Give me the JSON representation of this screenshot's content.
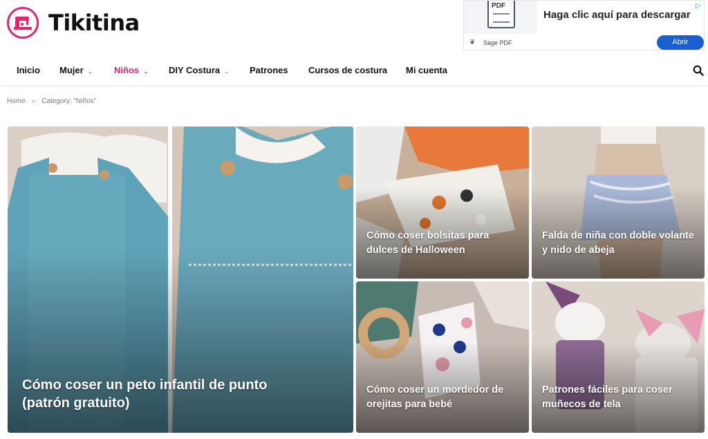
{
  "brand": {
    "name": "Tikitina",
    "accent": "#e6246e"
  },
  "ad": {
    "thumb_label": "PDF",
    "title": "Haga clic aquí para descargar",
    "brand": "Sage PDF",
    "button": "Abrir"
  },
  "nav": {
    "items": [
      {
        "label": "Inicio",
        "caret": ""
      },
      {
        "label": "Mujer",
        "caret": "⌄"
      },
      {
        "label": "Niños",
        "caret": "⌄"
      },
      {
        "label": "DIY Costura",
        "caret": "⌄"
      },
      {
        "label": "Patrones",
        "caret": ""
      },
      {
        "label": "Cursos de costura",
        "caret": ""
      },
      {
        "label": "Mi cuenta",
        "caret": ""
      }
    ]
  },
  "breadcrumb": {
    "home": "Home",
    "sep": "»",
    "current": "Category: \"Niños\""
  },
  "posts": [
    {
      "title": "Cómo coser un peto infantil de punto (patrón gratuito)"
    },
    {
      "title": "Cómo coser bolsitas para dulces de Halloween"
    },
    {
      "title": "Falda de niña con doble volante y nido de abeja"
    },
    {
      "title": "Cómo coser un mordedor de orejitas para bebé"
    },
    {
      "title": "Patrones fáciles para coser muñecos de tela"
    }
  ]
}
